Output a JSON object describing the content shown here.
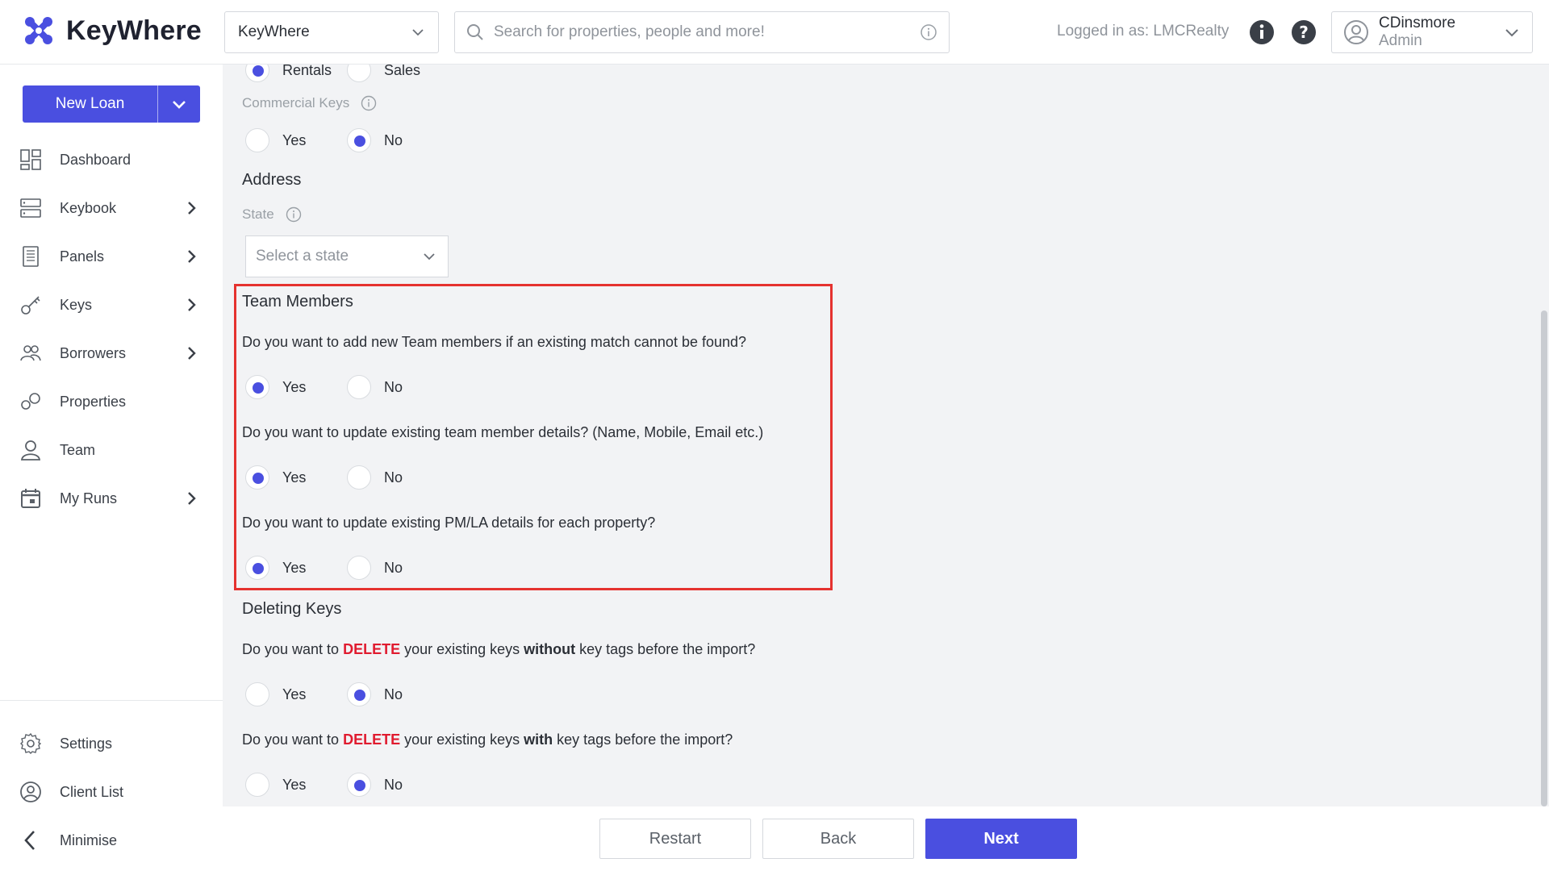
{
  "brand": {
    "name": "KeyWhere",
    "accent": "#4a4fe0"
  },
  "header": {
    "org_select_value": "KeyWhere",
    "search_placeholder": "Search for properties, people and more!",
    "logged_in_text": "Logged in as: LMCRealty",
    "user_name": "CDinsmore",
    "user_role": "Admin"
  },
  "sidebar": {
    "new_loan_label": "New Loan",
    "items": [
      {
        "label": "Dashboard",
        "icon": "dashboard-icon",
        "has_chevron": false
      },
      {
        "label": "Keybook",
        "icon": "keybook-icon",
        "has_chevron": true
      },
      {
        "label": "Panels",
        "icon": "panels-icon",
        "has_chevron": true
      },
      {
        "label": "Keys",
        "icon": "key-icon",
        "has_chevron": true
      },
      {
        "label": "Borrowers",
        "icon": "borrowers-icon",
        "has_chevron": true
      },
      {
        "label": "Properties",
        "icon": "properties-icon",
        "has_chevron": false
      },
      {
        "label": "Team",
        "icon": "team-icon",
        "has_chevron": false
      },
      {
        "label": "My Runs",
        "icon": "calendar-icon",
        "has_chevron": true
      }
    ],
    "bottom_items": [
      {
        "label": "Settings",
        "icon": "gear-icon"
      },
      {
        "label": "Client List",
        "icon": "client-list-icon"
      },
      {
        "label": "Minimise",
        "icon": "chevron-left-icon"
      }
    ]
  },
  "form": {
    "property_type": {
      "options": [
        "Rentals",
        "Sales"
      ],
      "selected": "Rentals"
    },
    "commercial_keys": {
      "label": "Commercial Keys",
      "options": [
        "Yes",
        "No"
      ],
      "selected": "No"
    },
    "address": {
      "title": "Address",
      "state_label": "State",
      "state_placeholder": "Select a state"
    },
    "team_members": {
      "title": "Team Members",
      "questions": [
        {
          "text": "Do you want to add new Team members if an existing match cannot be found?",
          "options": [
            "Yes",
            "No"
          ],
          "selected": "Yes"
        },
        {
          "text": "Do you want to update existing team member details? (Name, Mobile, Email etc.)",
          "options": [
            "Yes",
            "No"
          ],
          "selected": "Yes"
        },
        {
          "text": "Do you want to update existing PM/LA details for each property?",
          "options": [
            "Yes",
            "No"
          ],
          "selected": "Yes"
        }
      ]
    },
    "deleting_keys": {
      "title": "Deleting Keys",
      "questions": [
        {
          "prefix": "Do you want to ",
          "emphasis": "DELETE",
          "middle": " your existing keys ",
          "bold": "without",
          "suffix": " key tags before the import?",
          "options": [
            "Yes",
            "No"
          ],
          "selected": "No"
        },
        {
          "prefix": "Do you want to ",
          "emphasis": "DELETE",
          "middle": " your existing keys ",
          "bold": "with",
          "suffix": " key tags before the import?",
          "options": [
            "Yes",
            "No"
          ],
          "selected": "No"
        }
      ]
    }
  },
  "footer": {
    "restart_label": "Restart",
    "back_label": "Back",
    "next_label": "Next"
  }
}
